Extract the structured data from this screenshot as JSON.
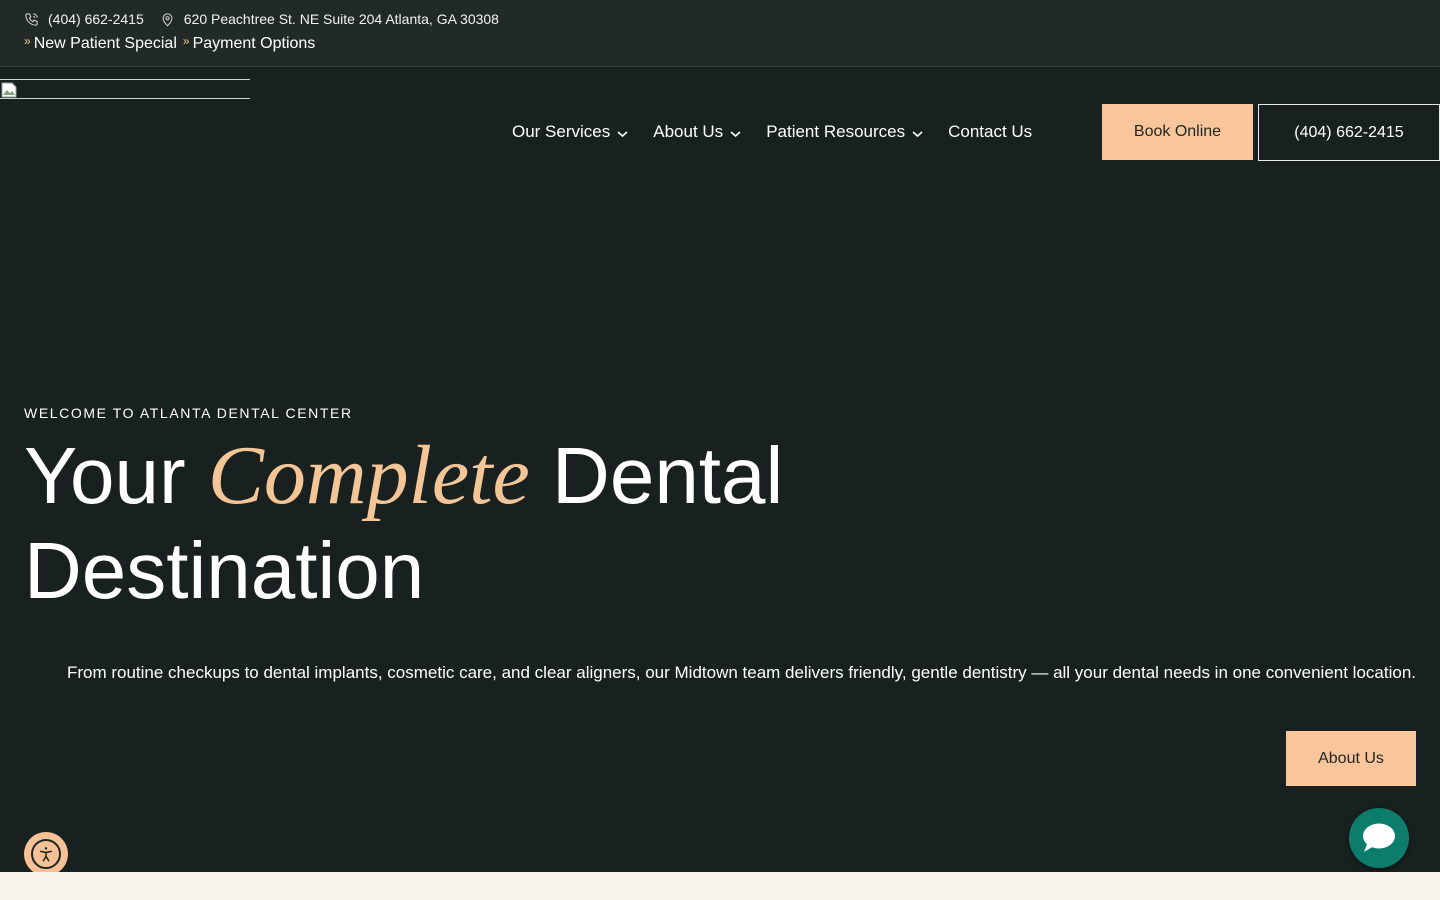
{
  "topbar": {
    "phone": "(404) 662-2415",
    "address": "620 Peachtree St. NE Suite 204 Atlanta, GA 30308",
    "links": [
      {
        "label": "New Patient Special"
      },
      {
        "label": "Payment Options"
      }
    ]
  },
  "nav": {
    "items": [
      {
        "label": "Our Services",
        "has_dropdown": true
      },
      {
        "label": "About Us",
        "has_dropdown": true
      },
      {
        "label": "Patient Resources",
        "has_dropdown": true
      },
      {
        "label": "Contact Us",
        "has_dropdown": false
      }
    ],
    "book_label": "Book Online",
    "phone_label": "(404) 662-2415"
  },
  "hero": {
    "eyebrow": "WELCOME TO ATLANTA DENTAL CENTER",
    "headline_pre": "Your",
    "headline_accent": "Complete",
    "headline_post": "Dental",
    "headline_line2": "Destination",
    "lede": "From routine checkups to dental implants, cosmetic care, and clear aligners, our Midtown team delivers friendly, gentle dentistry — all your dental needs in one convenient location.",
    "cta_label": "About Us"
  },
  "widgets": {
    "accessibility_icon": "accessibility-icon",
    "chat_icon": "chat-bubble-icon"
  },
  "colors": {
    "background": "#18211f",
    "topbar": "#222a28",
    "accent": "#f9c59a",
    "chat": "#0d7d6b",
    "footer_band": "#f8f4ec"
  }
}
